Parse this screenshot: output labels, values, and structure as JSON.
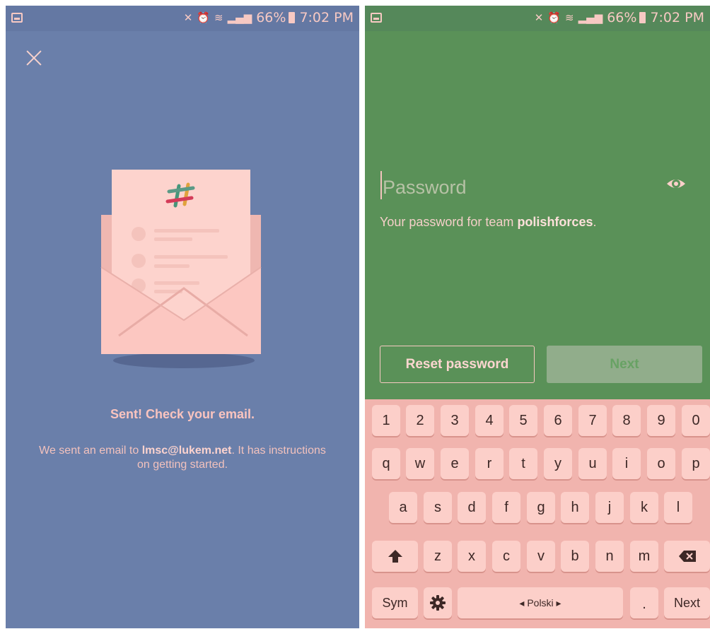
{
  "left_screen": {
    "status": {
      "battery": "66%",
      "time": "7:02 PM"
    },
    "title": "Sent! Check your email.",
    "message_prefix": "We sent an email to ",
    "email": "lmsc@lukem.net",
    "message_suffix": ". It has instructions on getting started."
  },
  "right_screen": {
    "status": {
      "battery": "66%",
      "time": "7:02 PM"
    },
    "password_placeholder": "Password",
    "hint_prefix": "Your password for team ",
    "team": "polishforces",
    "hint_suffix": ".",
    "reset_label": "Reset password",
    "next_label": "Next"
  },
  "keyboard": {
    "row_numbers": [
      "1",
      "2",
      "3",
      "4",
      "5",
      "6",
      "7",
      "8",
      "9",
      "0"
    ],
    "row_top": [
      "q",
      "w",
      "e",
      "r",
      "t",
      "y",
      "u",
      "i",
      "o",
      "p"
    ],
    "row_mid": [
      "a",
      "s",
      "d",
      "f",
      "g",
      "h",
      "j",
      "k",
      "l"
    ],
    "row_bot": [
      "z",
      "x",
      "c",
      "v",
      "b",
      "n",
      "m"
    ],
    "sym_label": "Sym",
    "space_label": "◂ Polski ▸",
    "period_label": ".",
    "enter_label": "Next"
  },
  "icons": {
    "close": "close-icon",
    "eye": "eye-icon",
    "shift": "shift-icon",
    "backspace": "backspace-icon",
    "settings": "gear-icon"
  },
  "colors": {
    "left_bg": "#6a7faa",
    "right_bg": "#5a9158",
    "keyboard_bg": "#f1b4ae",
    "key_bg": "#fccfc9"
  }
}
